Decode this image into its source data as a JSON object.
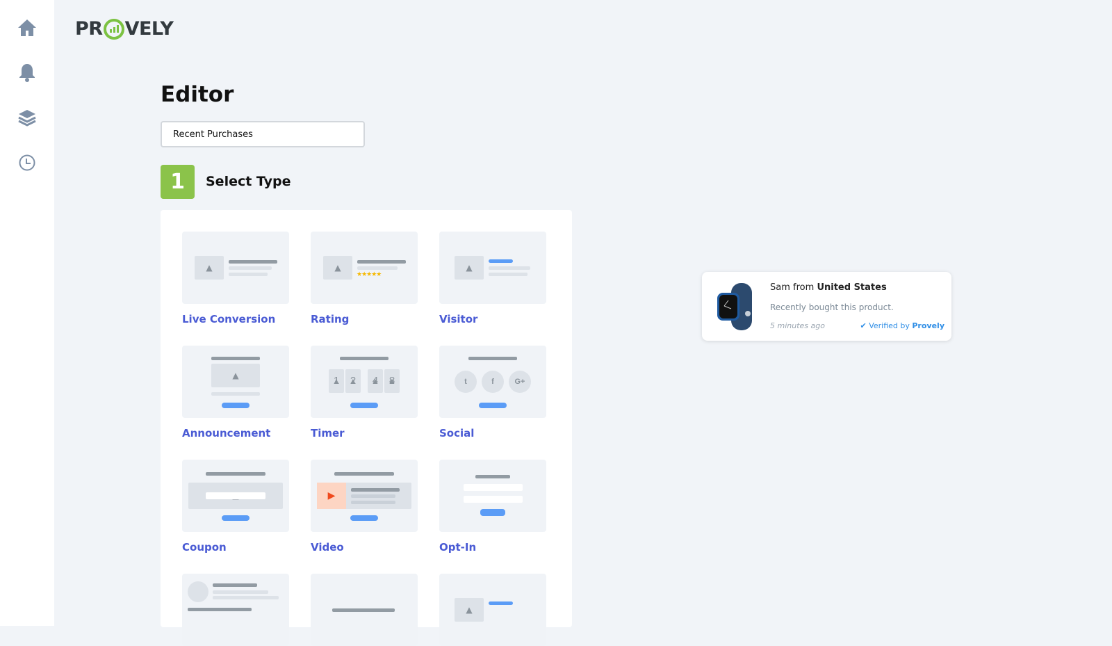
{
  "sidebar": {
    "items": [
      {
        "icon": "home-icon"
      },
      {
        "icon": "bell-icon"
      },
      {
        "icon": "layers-icon"
      },
      {
        "icon": "clock-icon"
      }
    ]
  },
  "brand": {
    "logo_text": "PROVELY",
    "accent": "#7cc242"
  },
  "page": {
    "title": "Editor",
    "name_value": "Recent Purchases"
  },
  "step": {
    "number": "1",
    "title": "Select Type",
    "color": "#8bc34a"
  },
  "types": [
    "Live Conversion",
    "Rating",
    "Visitor",
    "Announcement",
    "Timer",
    "Social",
    "Coupon",
    "Video",
    "Opt-In"
  ],
  "timer_digits": [
    "1",
    "2",
    "4",
    "8"
  ],
  "notification": {
    "name": "Sam",
    "from": "from",
    "location": "United States",
    "message": "Recently bought this product.",
    "time": "5 minutes ago",
    "verified_prefix": "Verified by",
    "verified_brand": "Provely"
  }
}
